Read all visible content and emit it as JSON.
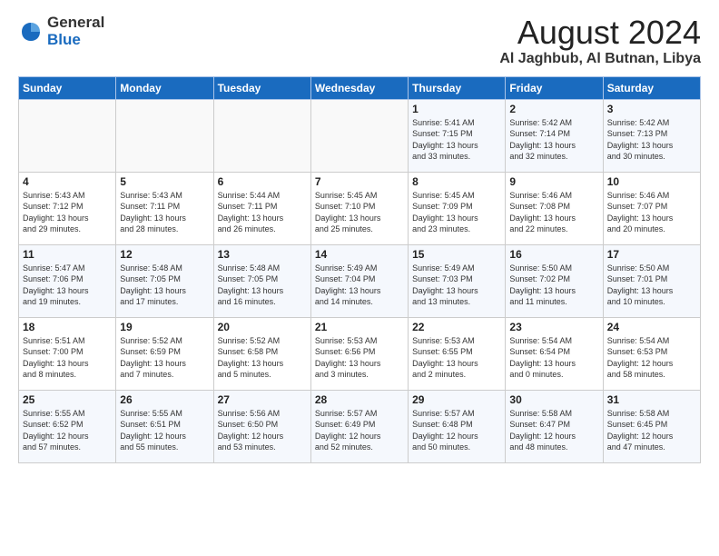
{
  "header": {
    "logo_general": "General",
    "logo_blue": "Blue",
    "title": "August 2024",
    "subtitle": "Al Jaghbub, Al Butnan, Libya"
  },
  "calendar": {
    "days_of_week": [
      "Sunday",
      "Monday",
      "Tuesday",
      "Wednesday",
      "Thursday",
      "Friday",
      "Saturday"
    ],
    "weeks": [
      [
        {
          "day": "",
          "info": ""
        },
        {
          "day": "",
          "info": ""
        },
        {
          "day": "",
          "info": ""
        },
        {
          "day": "",
          "info": ""
        },
        {
          "day": "1",
          "info": "Sunrise: 5:41 AM\nSunset: 7:15 PM\nDaylight: 13 hours\nand 33 minutes."
        },
        {
          "day": "2",
          "info": "Sunrise: 5:42 AM\nSunset: 7:14 PM\nDaylight: 13 hours\nand 32 minutes."
        },
        {
          "day": "3",
          "info": "Sunrise: 5:42 AM\nSunset: 7:13 PM\nDaylight: 13 hours\nand 30 minutes."
        }
      ],
      [
        {
          "day": "4",
          "info": "Sunrise: 5:43 AM\nSunset: 7:12 PM\nDaylight: 13 hours\nand 29 minutes."
        },
        {
          "day": "5",
          "info": "Sunrise: 5:43 AM\nSunset: 7:11 PM\nDaylight: 13 hours\nand 28 minutes."
        },
        {
          "day": "6",
          "info": "Sunrise: 5:44 AM\nSunset: 7:11 PM\nDaylight: 13 hours\nand 26 minutes."
        },
        {
          "day": "7",
          "info": "Sunrise: 5:45 AM\nSunset: 7:10 PM\nDaylight: 13 hours\nand 25 minutes."
        },
        {
          "day": "8",
          "info": "Sunrise: 5:45 AM\nSunset: 7:09 PM\nDaylight: 13 hours\nand 23 minutes."
        },
        {
          "day": "9",
          "info": "Sunrise: 5:46 AM\nSunset: 7:08 PM\nDaylight: 13 hours\nand 22 minutes."
        },
        {
          "day": "10",
          "info": "Sunrise: 5:46 AM\nSunset: 7:07 PM\nDaylight: 13 hours\nand 20 minutes."
        }
      ],
      [
        {
          "day": "11",
          "info": "Sunrise: 5:47 AM\nSunset: 7:06 PM\nDaylight: 13 hours\nand 19 minutes."
        },
        {
          "day": "12",
          "info": "Sunrise: 5:48 AM\nSunset: 7:05 PM\nDaylight: 13 hours\nand 17 minutes."
        },
        {
          "day": "13",
          "info": "Sunrise: 5:48 AM\nSunset: 7:05 PM\nDaylight: 13 hours\nand 16 minutes."
        },
        {
          "day": "14",
          "info": "Sunrise: 5:49 AM\nSunset: 7:04 PM\nDaylight: 13 hours\nand 14 minutes."
        },
        {
          "day": "15",
          "info": "Sunrise: 5:49 AM\nSunset: 7:03 PM\nDaylight: 13 hours\nand 13 minutes."
        },
        {
          "day": "16",
          "info": "Sunrise: 5:50 AM\nSunset: 7:02 PM\nDaylight: 13 hours\nand 11 minutes."
        },
        {
          "day": "17",
          "info": "Sunrise: 5:50 AM\nSunset: 7:01 PM\nDaylight: 13 hours\nand 10 minutes."
        }
      ],
      [
        {
          "day": "18",
          "info": "Sunrise: 5:51 AM\nSunset: 7:00 PM\nDaylight: 13 hours\nand 8 minutes."
        },
        {
          "day": "19",
          "info": "Sunrise: 5:52 AM\nSunset: 6:59 PM\nDaylight: 13 hours\nand 7 minutes."
        },
        {
          "day": "20",
          "info": "Sunrise: 5:52 AM\nSunset: 6:58 PM\nDaylight: 13 hours\nand 5 minutes."
        },
        {
          "day": "21",
          "info": "Sunrise: 5:53 AM\nSunset: 6:56 PM\nDaylight: 13 hours\nand 3 minutes."
        },
        {
          "day": "22",
          "info": "Sunrise: 5:53 AM\nSunset: 6:55 PM\nDaylight: 13 hours\nand 2 minutes."
        },
        {
          "day": "23",
          "info": "Sunrise: 5:54 AM\nSunset: 6:54 PM\nDaylight: 13 hours\nand 0 minutes."
        },
        {
          "day": "24",
          "info": "Sunrise: 5:54 AM\nSunset: 6:53 PM\nDaylight: 12 hours\nand 58 minutes."
        }
      ],
      [
        {
          "day": "25",
          "info": "Sunrise: 5:55 AM\nSunset: 6:52 PM\nDaylight: 12 hours\nand 57 minutes."
        },
        {
          "day": "26",
          "info": "Sunrise: 5:55 AM\nSunset: 6:51 PM\nDaylight: 12 hours\nand 55 minutes."
        },
        {
          "day": "27",
          "info": "Sunrise: 5:56 AM\nSunset: 6:50 PM\nDaylight: 12 hours\nand 53 minutes."
        },
        {
          "day": "28",
          "info": "Sunrise: 5:57 AM\nSunset: 6:49 PM\nDaylight: 12 hours\nand 52 minutes."
        },
        {
          "day": "29",
          "info": "Sunrise: 5:57 AM\nSunset: 6:48 PM\nDaylight: 12 hours\nand 50 minutes."
        },
        {
          "day": "30",
          "info": "Sunrise: 5:58 AM\nSunset: 6:47 PM\nDaylight: 12 hours\nand 48 minutes."
        },
        {
          "day": "31",
          "info": "Sunrise: 5:58 AM\nSunset: 6:45 PM\nDaylight: 12 hours\nand 47 minutes."
        }
      ]
    ]
  }
}
